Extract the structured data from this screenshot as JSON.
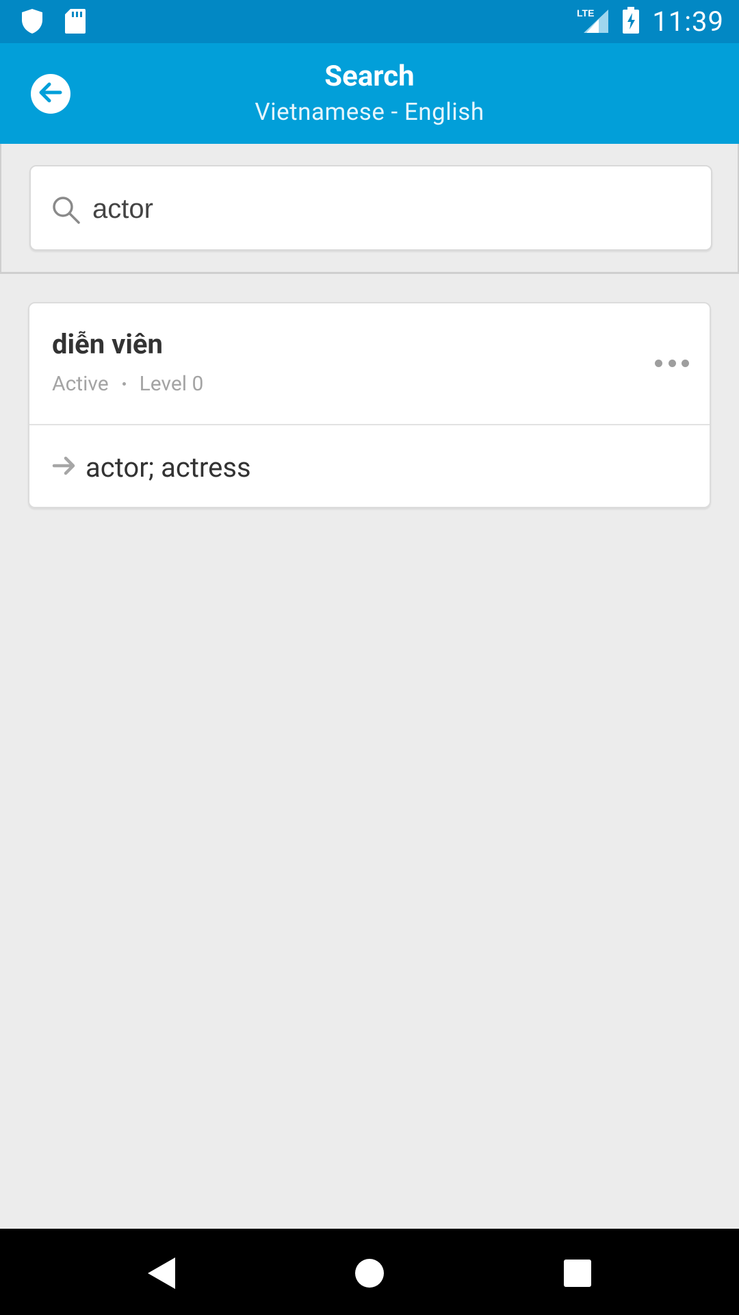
{
  "status_bar": {
    "time": "11:39",
    "network": "LTE",
    "left_icons": [
      "shield-icon",
      "sd-card-icon"
    ],
    "right_icons": [
      "lte-signal-icon",
      "battery-charging-icon"
    ]
  },
  "app_bar": {
    "title": "Search",
    "subtitle": "Vietnamese - English",
    "back_icon": "back-arrow-icon",
    "color": "#029fd9"
  },
  "search": {
    "value": "actor",
    "icon": "search-icon"
  },
  "results": [
    {
      "word": "diễn viên",
      "status": "Active",
      "level": "Level 0",
      "translation": "actor; actress",
      "more_icon": "more-horizontal-icon",
      "translation_icon": "arrow-right-icon"
    }
  ],
  "nav_bar": {
    "buttons": [
      "back-triangle-icon",
      "home-circle-icon",
      "recents-square-icon"
    ]
  }
}
